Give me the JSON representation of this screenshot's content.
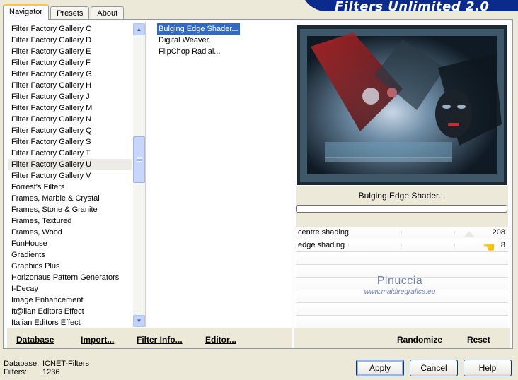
{
  "app": {
    "brand": "Filters Unlimited 2.0"
  },
  "tabs": [
    {
      "label": "Navigator"
    },
    {
      "label": "Presets"
    },
    {
      "label": "About"
    }
  ],
  "categories": {
    "items": [
      "Filter Factory Gallery C",
      "Filter Factory Gallery D",
      "Filter Factory Gallery E",
      "Filter Factory Gallery F",
      "Filter Factory Gallery G",
      "Filter Factory Gallery H",
      "Filter Factory Gallery J",
      "Filter Factory Gallery M",
      "Filter Factory Gallery N",
      "Filter Factory Gallery Q",
      "Filter Factory Gallery S",
      "Filter Factory Gallery T",
      "Filter Factory Gallery U",
      "Filter Factory Gallery V",
      "Forrest's Filters",
      "Frames, Marble & Crystal",
      "Frames, Stone & Granite",
      "Frames, Textured",
      "Frames, Wood",
      "FunHouse",
      "Gradients",
      "Graphics Plus",
      "Horizonaus Pattern Generators",
      "I-Decay",
      "Image Enhancement",
      "It@lian Editors Effect",
      "Italian Editors Effect"
    ],
    "selected": "Filter Factory Gallery U"
  },
  "filters": {
    "items": [
      "Bulging Edge Shader...",
      "Digital Weaver...",
      "FlipChop Radial..."
    ],
    "selected": "Bulging Edge Shader..."
  },
  "current_filter": {
    "title": "Bulging Edge Shader..."
  },
  "parameters": [
    {
      "name": "centre shading",
      "value": "208"
    },
    {
      "name": "edge shading",
      "value": "8"
    }
  ],
  "watermark": {
    "line1": "Pinuccia",
    "line2": "www.maidiregrafica.eu"
  },
  "bottom_links": {
    "database": "Database",
    "import": "Import...",
    "filter_info": "Filter Info...",
    "editor": "Editor...",
    "randomize": "Randomize",
    "reset": "Reset"
  },
  "status": {
    "database_label": "Database:",
    "database_value": "ICNET-Filters",
    "filters_label": "Filters:",
    "filters_value": "1236"
  },
  "buttons": {
    "apply": "Apply",
    "cancel": "Cancel",
    "help": "Help"
  },
  "icons": {
    "scroll_up": "chevron-up-icon",
    "scroll_down": "chevron-down-icon",
    "pointer": "pointing-hand-icon"
  },
  "colors": {
    "brand_blue": "#0a2a8c",
    "selection": "#316ac5",
    "window_bg": "#ece9d8"
  }
}
